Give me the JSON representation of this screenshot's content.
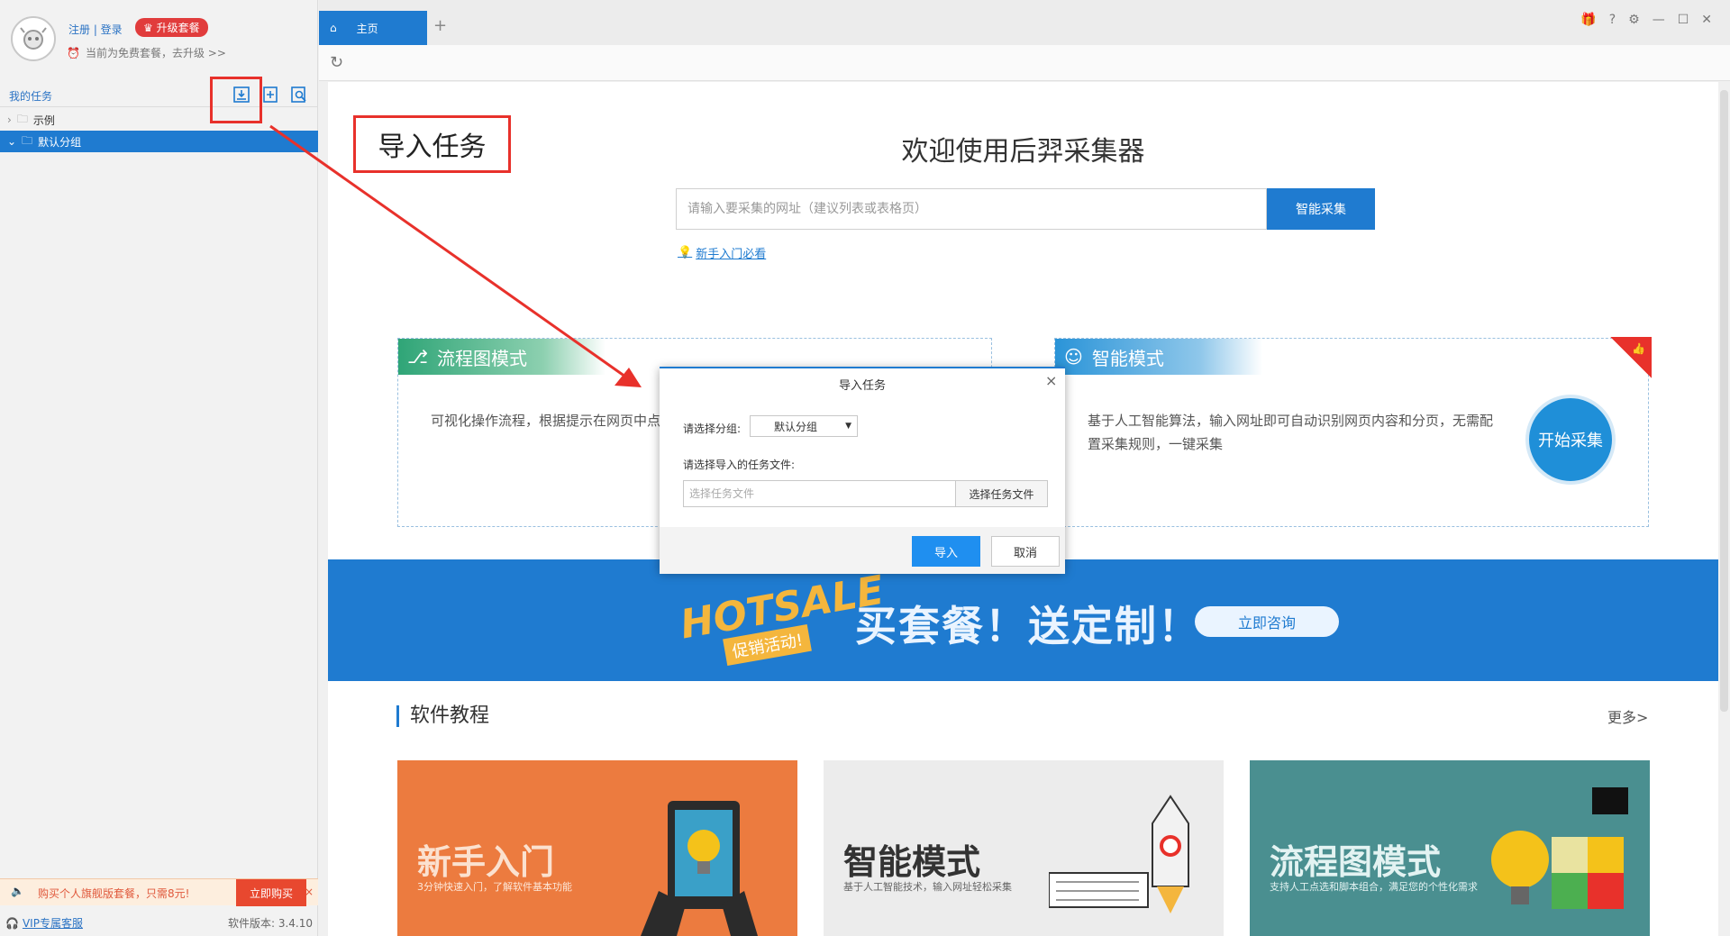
{
  "user": {
    "register_login": "注册 | 登录",
    "upgrade_label": "♛ 升级套餐",
    "plan_note": "当前为免费套餐，去升级 >>"
  },
  "sidebar": {
    "tasks_title": "我的任务",
    "tree": [
      {
        "label": "示例"
      },
      {
        "label": "默认分组"
      }
    ],
    "promo_text": "购买个人旗舰版套餐，只需8元!",
    "promo_buy": "立即购买",
    "promo_close": "×",
    "vip_link": "VIP专属客服",
    "version": "软件版本: 3.4.10"
  },
  "tabs": {
    "home": "主页",
    "add": "+"
  },
  "main": {
    "welcome_title": "欢迎使用后羿采集器",
    "url_placeholder": "请输入要采集的网址（建议列表或表格页）",
    "smart_button": "智能采集",
    "newbie_link": "新手入门必看",
    "flow_card": {
      "title": "流程图模式",
      "desc": "可视化操作流程，根据提示在网页中点击，可以模拟任何人为操作"
    },
    "smart_card": {
      "title": "智能模式",
      "desc": "基于人工智能算法，输入网址即可自动识别网页内容和分页，无需配置采集规则，一键采集",
      "start_button": "开始采集"
    },
    "banner": {
      "hotsale": "HOTSALE",
      "hotsale_sub": "促销活动!",
      "text": "买套餐！送定制！",
      "consult": "立即咨询"
    },
    "tutorial": {
      "title": "软件教程",
      "more": "更多>",
      "cards": [
        {
          "title": "新手入门",
          "sub": "3分钟快速入门，了解软件基本功能"
        },
        {
          "title": "智能模式",
          "sub": "基于人工智能技术，输入网址轻松采集"
        },
        {
          "title": "流程图模式",
          "sub": "支持人工点选和脚本组合，满足您的个性化需求"
        }
      ]
    }
  },
  "annotation": {
    "callout": "导入任务"
  },
  "dialog": {
    "title": "导入任务",
    "close": "×",
    "group_label": "请选择分组:",
    "group_value": "默认分组",
    "file_label": "请选择导入的任务文件:",
    "file_placeholder": "选择任务文件",
    "choose_button": "选择任务文件",
    "import_button": "导入",
    "cancel_button": "取消"
  },
  "colors": {
    "accent": "#1f7bd0",
    "annotation_red": "#e8312b",
    "flow_green": "#2fa577",
    "promo_orange": "#e8482f"
  }
}
